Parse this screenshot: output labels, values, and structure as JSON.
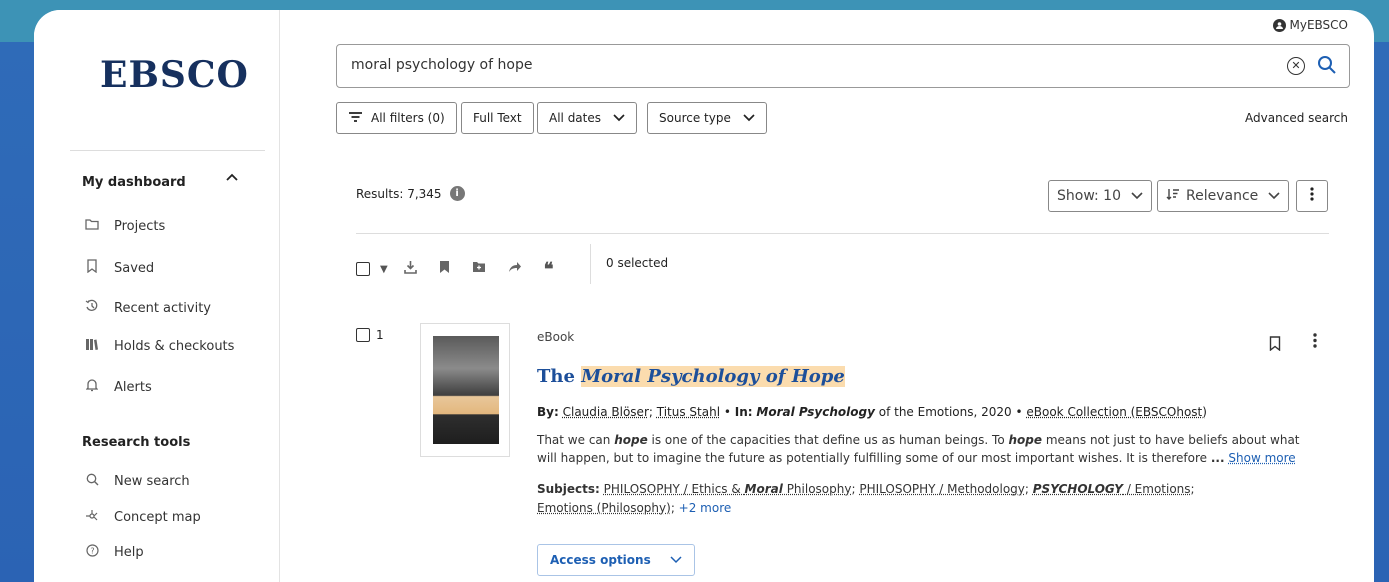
{
  "sidebar": {
    "logo": "EBSCO",
    "dashboard_title": "My dashboard",
    "dashboard_items": [
      {
        "label": "Projects",
        "icon": "folder-icon"
      },
      {
        "label": "Saved",
        "icon": "bookmark-icon"
      },
      {
        "label": "Recent activity",
        "icon": "history-icon"
      },
      {
        "label": "Holds & checkouts",
        "icon": "books-icon"
      },
      {
        "label": "Alerts",
        "icon": "bell-icon"
      }
    ],
    "tools_title": "Research tools",
    "tools_items": [
      {
        "label": "New search",
        "icon": "search-icon"
      },
      {
        "label": "Concept map",
        "icon": "concept-map-icon"
      },
      {
        "label": "Help",
        "icon": "help-icon"
      }
    ]
  },
  "header": {
    "account_label": "MyEBSCO",
    "search_value": "moral psychology of hope",
    "filters": {
      "all_filters": "All filters (0)",
      "full_text": "Full Text",
      "all_dates": "All dates",
      "source_type": "Source type"
    },
    "advanced_search": "Advanced search"
  },
  "results_bar": {
    "results_label": "Results: 7,345",
    "show_label": "Show: 10",
    "sort_label": "Relevance",
    "selected_label": "0 selected"
  },
  "result": {
    "number": "1",
    "type": "eBook",
    "title_prefix": "The",
    "title_highlight": "Moral Psychology of Hope",
    "by_label": "By:",
    "author1": "Claudia Blöser",
    "author2": "Titus Stahl",
    "in_label": "In:",
    "in_bold": "Moral Psychology",
    "in_rest": "of the Emotions, 2020",
    "collection": "eBook Collection (EBSCOhost)",
    "abstract_parts": {
      "p1": "That we can ",
      "b1": "hope",
      "p2": " is one of the capacities that define us as human beings. To ",
      "b2": "hope",
      "p3": " means not just to have beliefs about what will happen, but to imagine the future as potentially fulfilling some of our most important wishes. It is therefore ",
      "ellipsis": "...",
      "show_more": "Show more"
    },
    "subjects_label": "Subjects:",
    "subject1_pre": "PHILOSOPHY / Ethics & ",
    "subject1_bold": "Moral",
    "subject1_post": " Philosophy",
    "subject2": "PHILOSOPHY / Methodology",
    "subject3_bold": "PSYCHOLOGY",
    "subject3_post": " / Emotions",
    "subject4": "Emotions (Philosophy)",
    "more_subjects": "+2 more",
    "access_label": "Access options"
  }
}
